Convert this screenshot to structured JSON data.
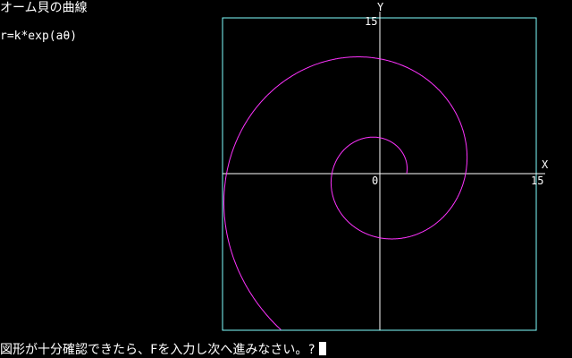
{
  "header": {
    "title": "オーム貝の曲線",
    "formula": "r=k*exp(aθ)"
  },
  "plot": {
    "y_axis_label": "Y",
    "x_axis_label": "X",
    "y_max_label": "15",
    "x_max_label": "15",
    "origin_label": "0",
    "spiral_description": "logarithmic spiral r=k*exp(aθ)"
  },
  "prompt": {
    "text": "図形が十分確認できたら、Fを入力し次へ進みなさい。?"
  },
  "colors": {
    "background": "#000000",
    "text": "#ffffff",
    "frame": "#7fffff",
    "axes": "#ffffff",
    "curve": "#ff33ff"
  }
}
